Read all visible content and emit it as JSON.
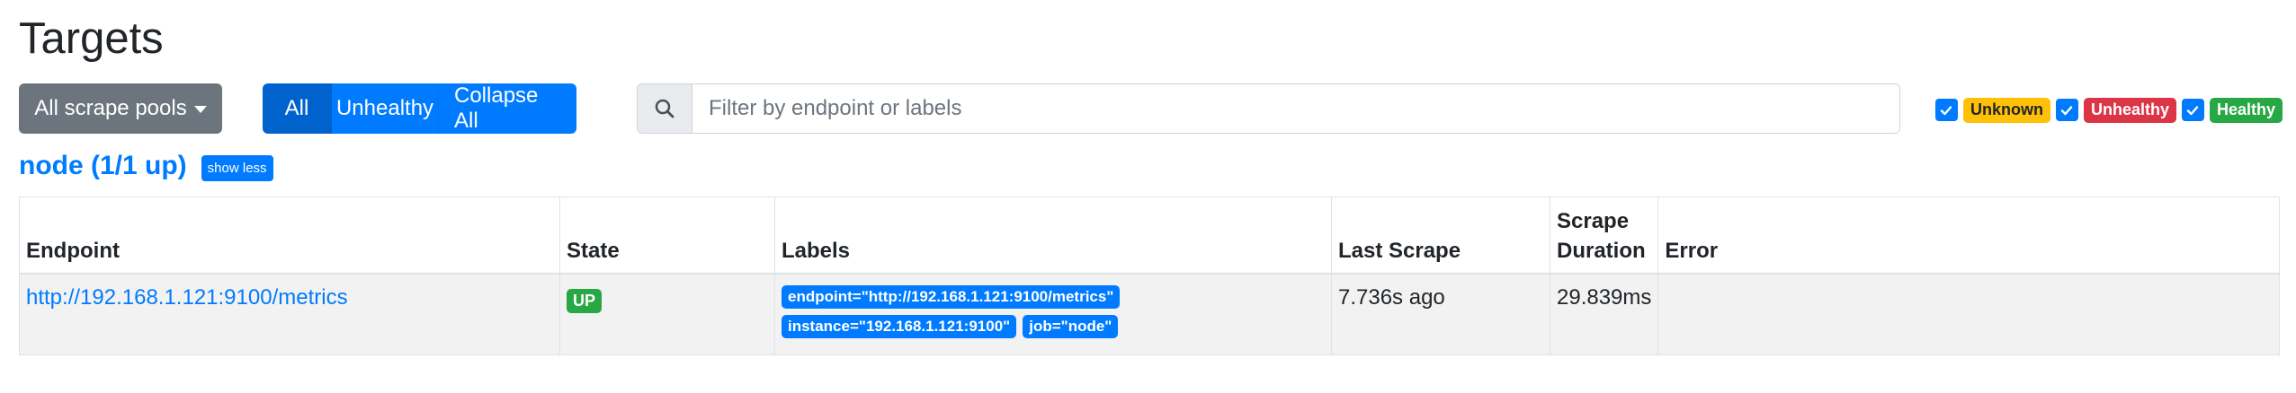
{
  "page": {
    "title": "Targets"
  },
  "toolbar": {
    "pools_label": "All scrape pools",
    "filters": [
      {
        "label": "All",
        "active": true
      },
      {
        "label": "Unhealthy",
        "active": false
      },
      {
        "label": "Collapse All",
        "active": false
      }
    ],
    "search_placeholder": "Filter by endpoint or labels"
  },
  "legend": [
    {
      "label": "Unknown",
      "checked": true,
      "color": "#ffc107"
    },
    {
      "label": "Unhealthy",
      "checked": true,
      "color": "#dc3545"
    },
    {
      "label": "Healthy",
      "checked": true,
      "color": "#28a745"
    }
  ],
  "pool": {
    "title": "node (1/1 up)",
    "toggle_label": "show less",
    "columns": [
      "Endpoint",
      "State",
      "Labels",
      "Last Scrape",
      "Scrape Duration",
      "Error"
    ],
    "rows": [
      {
        "endpoint": "http://192.168.1.121:9100/metrics",
        "state": "UP",
        "labels": [
          "endpoint=\"http://192.168.1.121:9100/metrics\"",
          "instance=\"192.168.1.121:9100\"",
          "job=\"node\""
        ],
        "last_scrape": "7.736s ago",
        "scrape_duration": "29.839ms",
        "error": ""
      }
    ]
  },
  "colors": {
    "primary": "#007bff",
    "secondary": "#6c757d",
    "success": "#28a745",
    "warning": "#ffc107",
    "danger": "#dc3545"
  }
}
